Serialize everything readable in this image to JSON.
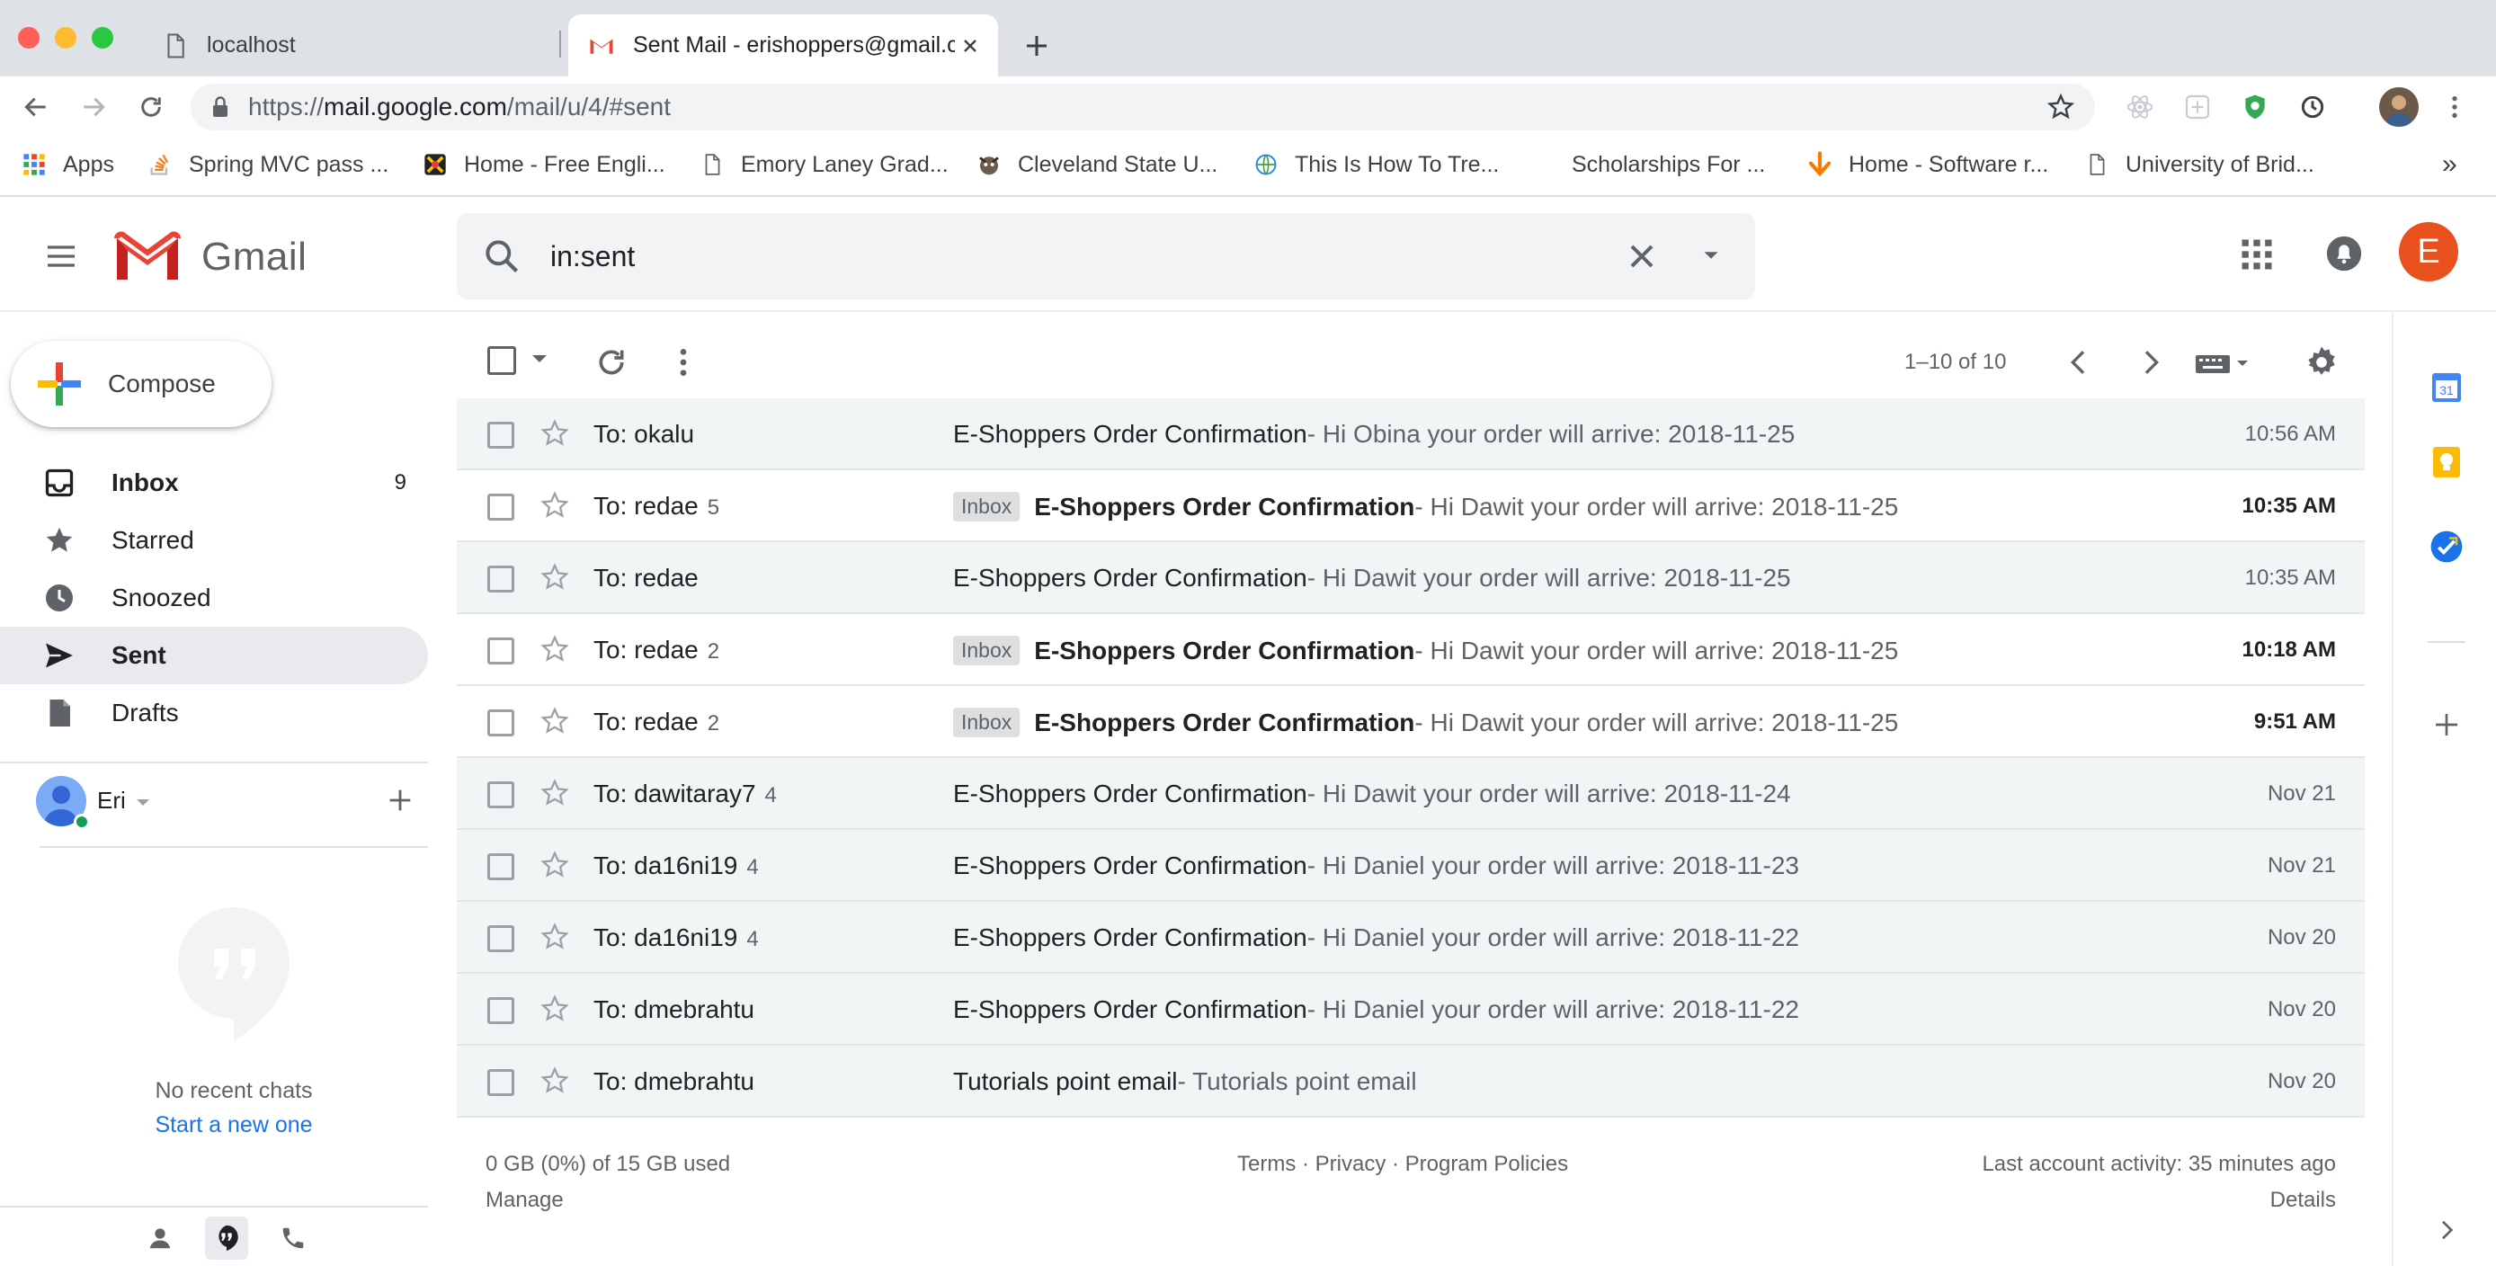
{
  "browser": {
    "tabs": [
      {
        "title": "localhost",
        "active": false
      },
      {
        "title": "Sent Mail - erishoppers@gmail.com",
        "active": true
      }
    ],
    "url_scheme": "https://",
    "url_host": "mail.google.com",
    "url_path": "/mail/u/4/#sent",
    "bookmarks": [
      {
        "label": "Apps",
        "icon": "apps-grid-icon"
      },
      {
        "label": "Spring MVC pass ...",
        "icon": "stackoverflow-icon"
      },
      {
        "label": "Home - Free Engli...",
        "icon": "colorful-logo-icon"
      },
      {
        "label": "Emory Laney Grad...",
        "icon": "page-icon"
      },
      {
        "label": "Cleveland State U...",
        "icon": "mascot-icon"
      },
      {
        "label": "This Is How To Tre...",
        "icon": "globe-icon"
      },
      {
        "label": "Scholarships For ...",
        "icon": ""
      },
      {
        "label": "Home - Software r...",
        "icon": "arrow-down-icon"
      },
      {
        "label": "University of Brid...",
        "icon": "page-icon"
      }
    ],
    "more_bookmarks": "»"
  },
  "gmail": {
    "logo_text": "Gmail",
    "search_value": "in:sent",
    "avatar_letter": "E",
    "compose_label": "Compose",
    "nav": [
      {
        "label": "Inbox",
        "count": "9",
        "icon": "inbox-icon"
      },
      {
        "label": "Starred",
        "count": "",
        "icon": "star-icon"
      },
      {
        "label": "Snoozed",
        "count": "",
        "icon": "clock-icon"
      },
      {
        "label": "Sent",
        "count": "",
        "icon": "send-icon",
        "active": true
      },
      {
        "label": "Drafts",
        "count": "",
        "icon": "draft-icon"
      }
    ],
    "hangouts": {
      "user_name": "Eri",
      "no_chats": "No recent chats",
      "start_new": "Start a new one"
    },
    "pagination": "1–10 of 10",
    "emails": [
      {
        "to": "To: okalu",
        "count": "",
        "badge": "",
        "subject": "E-Shoppers Order Confirmation",
        "snippet": " - Hi Obina your order will arrive: 2018-11-25",
        "time": "10:56 AM",
        "unread": false
      },
      {
        "to": "To: redae",
        "count": "5",
        "badge": "Inbox",
        "subject": "E-Shoppers Order Confirmation",
        "snippet": " - Hi Dawit your order will arrive: 2018-11-25",
        "time": "10:35 AM",
        "unread": true
      },
      {
        "to": "To: redae",
        "count": "",
        "badge": "",
        "subject": "E-Shoppers Order Confirmation",
        "snippet": " - Hi Dawit your order will arrive: 2018-11-25",
        "time": "10:35 AM",
        "unread": false
      },
      {
        "to": "To: redae",
        "count": "2",
        "badge": "Inbox",
        "subject": "E-Shoppers Order Confirmation",
        "snippet": " - Hi Dawit your order will arrive: 2018-11-25",
        "time": "10:18 AM",
        "unread": true
      },
      {
        "to": "To: redae",
        "count": "2",
        "badge": "Inbox",
        "subject": "E-Shoppers Order Confirmation",
        "snippet": " - Hi Dawit your order will arrive: 2018-11-25",
        "time": "9:51 AM",
        "unread": true
      },
      {
        "to": "To: dawitaray7",
        "count": "4",
        "badge": "",
        "subject": "E-Shoppers Order Confirmation",
        "snippet": " - Hi Dawit your order will arrive: 2018-11-24",
        "time": "Nov 21",
        "unread": false
      },
      {
        "to": "To: da16ni19",
        "count": "4",
        "badge": "",
        "subject": "E-Shoppers Order Confirmation",
        "snippet": " - Hi Daniel your order will arrive: 2018-11-23",
        "time": "Nov 21",
        "unread": false
      },
      {
        "to": "To: da16ni19",
        "count": "4",
        "badge": "",
        "subject": "E-Shoppers Order Confirmation",
        "snippet": " - Hi Daniel your order will arrive: 2018-11-22",
        "time": "Nov 20",
        "unread": false
      },
      {
        "to": "To: dmebrahtu",
        "count": "",
        "badge": "",
        "subject": "E-Shoppers Order Confirmation",
        "snippet": " - Hi Daniel your order will arrive: 2018-11-22",
        "time": "Nov 20",
        "unread": false
      },
      {
        "to": "To: dmebrahtu",
        "count": "",
        "badge": "",
        "subject": "Tutorials point email",
        "snippet": " - Tutorials point email",
        "time": "Nov 20",
        "unread": false
      }
    ],
    "footer": {
      "storage": "0 GB (0%) of 15 GB used",
      "manage": "Manage",
      "links": "Terms · Privacy · Program Policies",
      "activity": "Last account activity: 35 minutes ago",
      "details": "Details"
    },
    "side_panel": {
      "calendar_day": "31"
    }
  },
  "colors": {
    "accent_red": "#ea4335",
    "link_blue": "#1a73e8",
    "active_nav_bg": "#e8eaed",
    "avatar": "#e8501e"
  }
}
